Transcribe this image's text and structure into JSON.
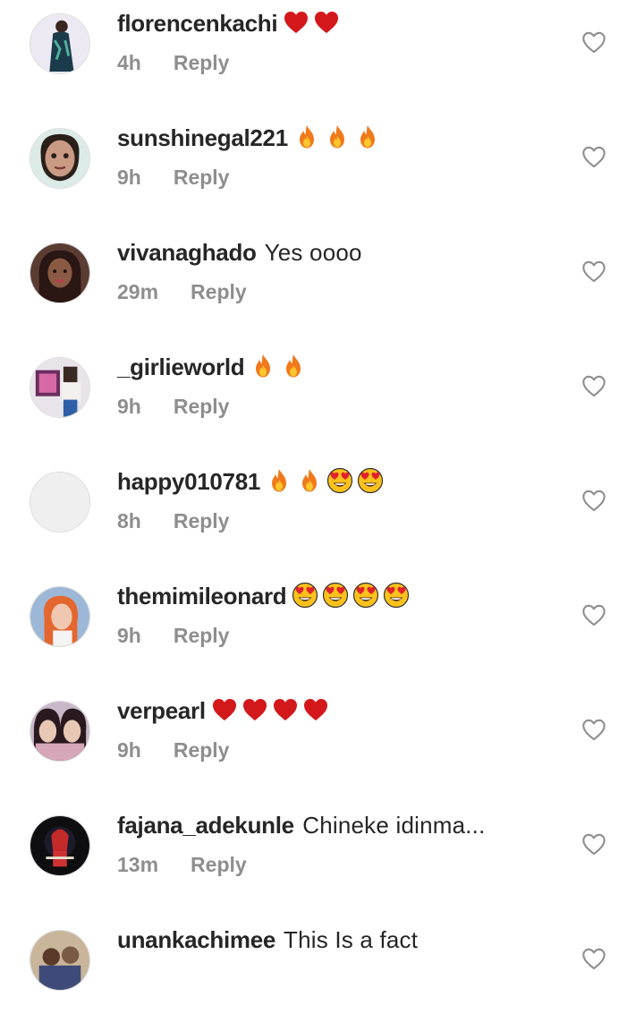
{
  "comments": [
    {
      "username": "florencenkachi",
      "text": "",
      "emojis": [
        "heart",
        "heart"
      ],
      "time": "4h",
      "reply": "Reply",
      "avatar": "dark-dress"
    },
    {
      "username": "sunshinegal221",
      "text": "",
      "emojis": [
        "fire",
        "fire",
        "fire"
      ],
      "time": "9h",
      "reply": "Reply",
      "avatar": "face-light"
    },
    {
      "username": "vivanaghado",
      "text": "Yes oooo",
      "emojis": [],
      "time": "29m",
      "reply": "Reply",
      "avatar": "woman-dark"
    },
    {
      "username": "_girlieworld",
      "text": "",
      "emojis": [
        "fire",
        "fire"
      ],
      "time": "9h",
      "reply": "Reply",
      "avatar": "collage"
    },
    {
      "username": "happy010781",
      "text": "",
      "emojis": [
        "fire",
        "fire",
        "heart-eyes",
        "heart-eyes"
      ],
      "time": "8h",
      "reply": "Reply",
      "avatar": "blank"
    },
    {
      "username": "themimileonard",
      "text": "",
      "emojis": [
        "heart-eyes",
        "heart-eyes",
        "heart-eyes",
        "heart-eyes"
      ],
      "time": "9h",
      "reply": "Reply",
      "avatar": "redhair"
    },
    {
      "username": "verpearl",
      "text": "",
      "emojis": [
        "heart",
        "heart",
        "heart",
        "heart"
      ],
      "time": "9h",
      "reply": "Reply",
      "avatar": "twins"
    },
    {
      "username": "fajana_adekunle",
      "text": "Chineke idinma...",
      "emojis": [],
      "time": "13m",
      "reply": "Reply",
      "avatar": "dark-logo"
    },
    {
      "username": "unankachimee",
      "text": "This Is a fact",
      "emojis": [],
      "time": "",
      "reply": "",
      "avatar": "group"
    }
  ]
}
